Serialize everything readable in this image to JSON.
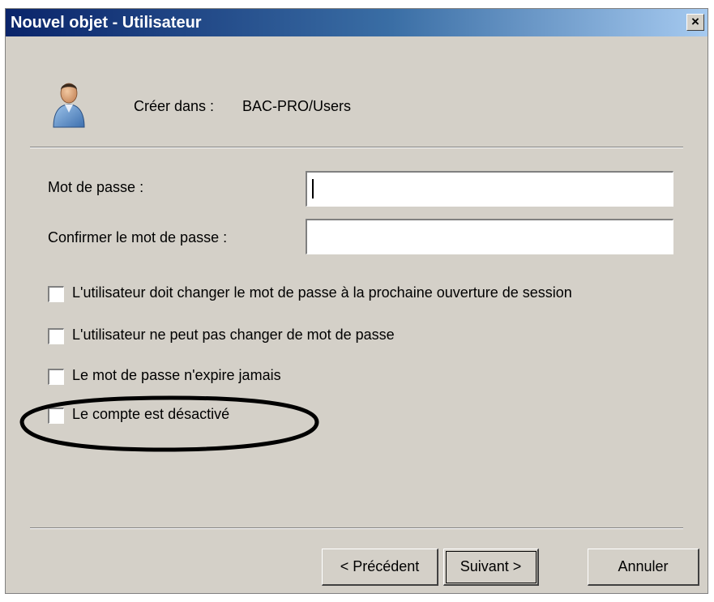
{
  "window": {
    "title": "Nouvel objet - Utilisateur",
    "close_glyph": "×"
  },
  "header": {
    "create_in_label": "Créer dans :",
    "create_in_path": "BAC-PRO/Users",
    "icon": "user-icon"
  },
  "form": {
    "password_label": "Mot de passe :",
    "password_value": "",
    "confirm_label": "Confirmer le mot de passe :",
    "confirm_value": ""
  },
  "options": [
    {
      "label": "L'utilisateur doit changer le mot de passe à la prochaine ouverture de session",
      "checked": false
    },
    {
      "label": "L'utilisateur ne peut pas changer de mot de passe",
      "checked": false
    },
    {
      "label": "Le mot de passe n'expire jamais",
      "checked": false
    },
    {
      "label": "Le compte est désactivé",
      "checked": false
    }
  ],
  "buttons": {
    "back": "< Précédent",
    "next": "Suivant >",
    "cancel": "Annuler"
  },
  "colors": {
    "dialog_bg": "#d4d0c8",
    "title_start": "#0a246a",
    "title_end": "#a6caf0",
    "annotation": "#000000"
  }
}
